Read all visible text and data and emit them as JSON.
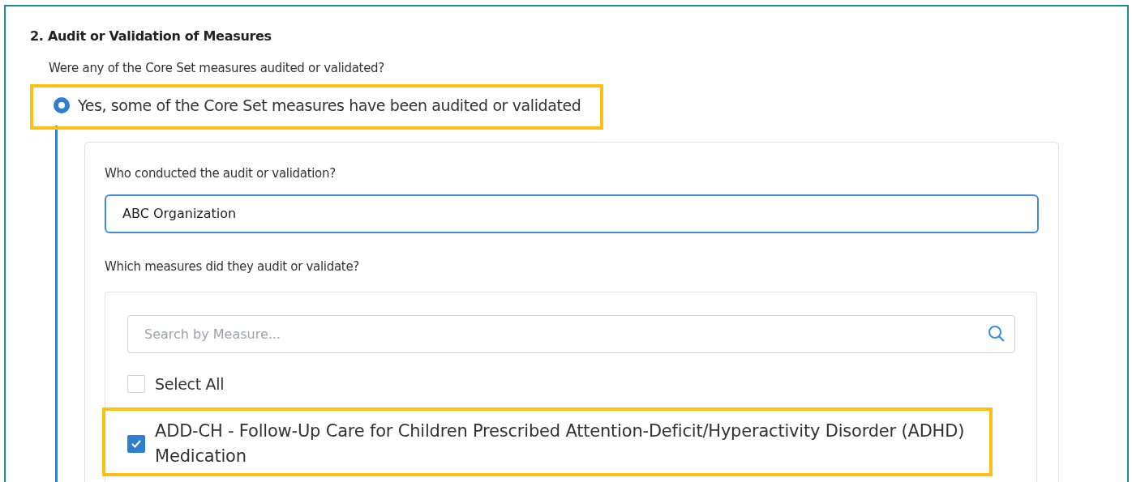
{
  "section": {
    "heading": "2. Audit or Validation of Measures",
    "question": "Were any of the Core Set measures audited or validated?",
    "options": [
      {
        "label": "Yes, some of the Core Set measures have been audited or validated",
        "selected": true,
        "highlighted": true
      }
    ],
    "followup": {
      "who_label": "Who conducted the audit or validation?",
      "who_value": "ABC Organization",
      "which_label": "Which measures did they audit or validate?",
      "search": {
        "placeholder": "Search by Measure..."
      },
      "select_all": {
        "label": "Select All",
        "checked": false
      },
      "measures": [
        {
          "label": "ADD-CH - Follow-Up Care for Children Prescribed Attention-Deficit/Hyperactivity Disorder (ADHD) Medication",
          "checked": true,
          "highlighted": true
        }
      ]
    }
  }
}
